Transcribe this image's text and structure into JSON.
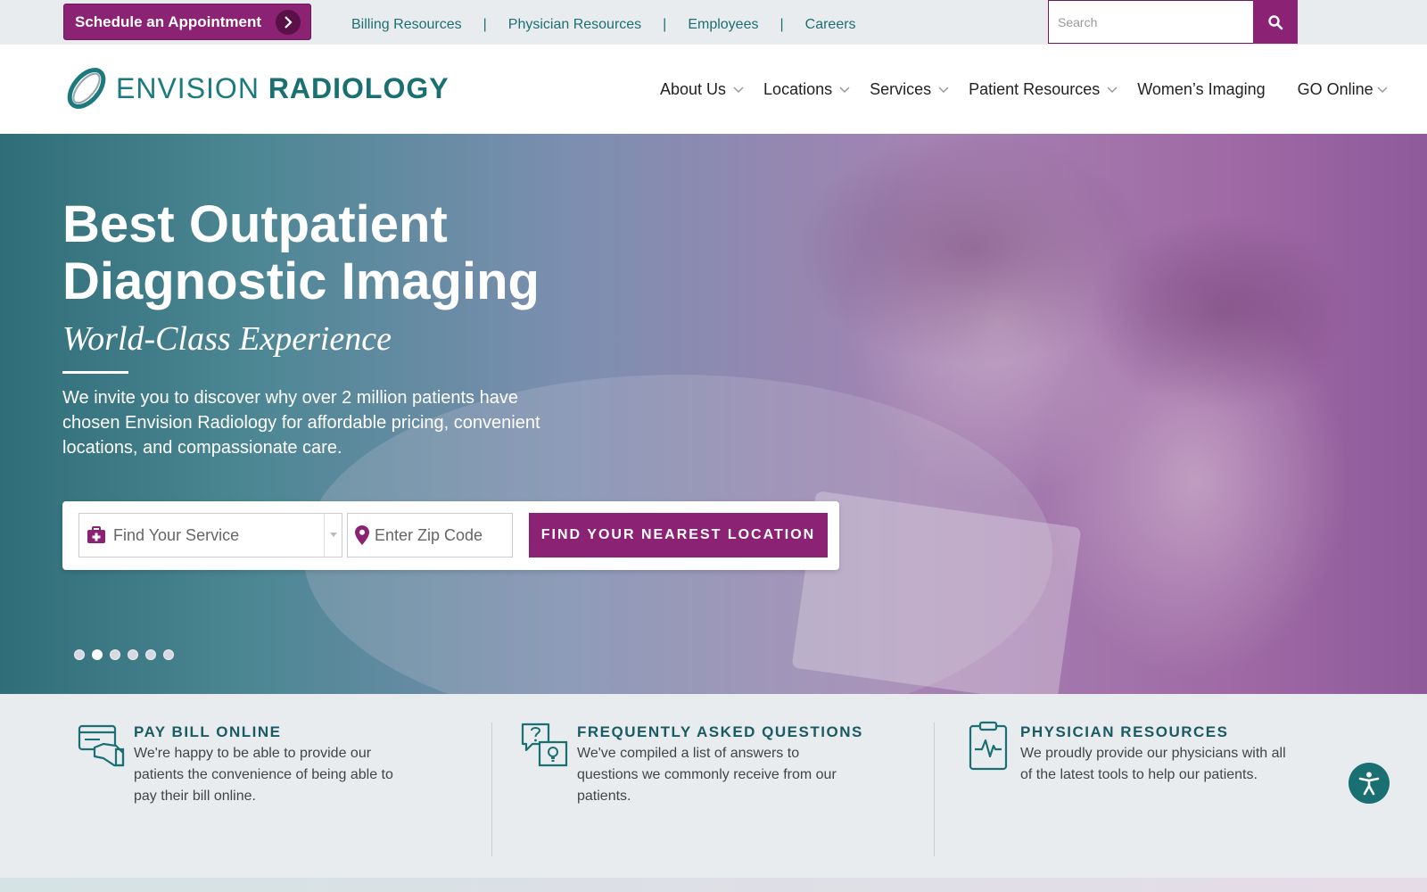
{
  "topbar": {
    "schedule_label": "Schedule an Appointment",
    "links": [
      "Billing Resources",
      "Physician Resources",
      "Employees",
      "Careers"
    ],
    "separator": "|",
    "search_placeholder": "Search"
  },
  "header": {
    "logo_word1": "ENVISION",
    "logo_word2": "RADIOLOGY",
    "nav": [
      {
        "label": "About Us",
        "has_dropdown": true
      },
      {
        "label": "Locations",
        "has_dropdown": true
      },
      {
        "label": "Services",
        "has_dropdown": true
      },
      {
        "label": "Patient Resources",
        "has_dropdown": true
      },
      {
        "label": "Women’s Imaging",
        "has_dropdown": false
      },
      {
        "label": "GO Online",
        "has_dropdown": true
      }
    ]
  },
  "hero": {
    "title": "Best Outpatient Diagnostic Imaging",
    "tagline": "World-Class Experience",
    "intro": "We invite you to discover why over 2 million patients have chosen Envision Radiology for affordable pricing, convenient locations, and compassionate care.",
    "service_placeholder": "Find Your Service",
    "zip_placeholder": "Enter Zip Code",
    "find_button": "FIND YOUR NEAREST LOCATION",
    "slide_count": 6,
    "active_slide": 2
  },
  "features": [
    {
      "icon": "credit-card-hand-icon",
      "title": "PAY BILL ONLINE",
      "text": "We're happy to be able to provide our patients the convenience of being able to pay their bill online."
    },
    {
      "icon": "question-chat-icon",
      "title": "FREQUENTLY ASKED QUESTIONS",
      "text": "We've compiled a list of answers to questions we commonly receive from our patients."
    },
    {
      "icon": "clipboard-pulse-icon",
      "title": "PHYSICIAN RESOURCES",
      "text": "We proudly provide our physicians with all of the latest tools to help our patients."
    }
  ],
  "colors": {
    "brand_purple": "#8b2273",
    "brand_teal": "#1a6f72",
    "background": "#e8ecef"
  }
}
